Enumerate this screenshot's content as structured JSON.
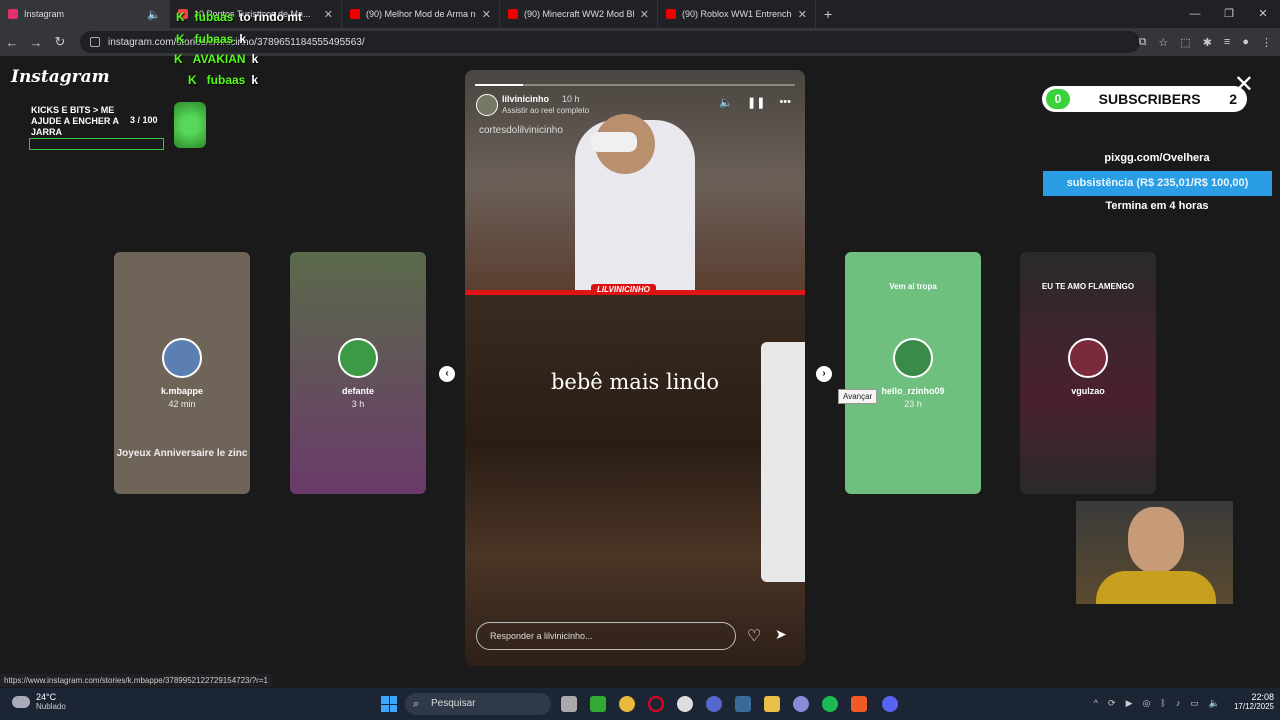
{
  "browser": {
    "tabs": [
      {
        "label": "Instagram",
        "fav_color": "#e1306c",
        "active": true
      },
      {
        "label": "10 Pontos Turísticos de Ma...",
        "fav_color": "#e44",
        "active": false
      },
      {
        "label": "(90) Melhor Mod de Arma no M",
        "fav_color": "#e00",
        "active": false
      },
      {
        "label": "(90) Minecraft WW2 Mod Block",
        "fav_color": "#e00",
        "active": false
      },
      {
        "label": "(90) Roblox WW1 Entrenched (l",
        "fav_color": "#e00",
        "active": false
      }
    ],
    "url": "instagram.com/stories/lilvinicinho/3789651184555495563/",
    "status_url": "https://www.instagram.com/stories/k.mbappe/3789952122729154723/?r=1"
  },
  "instagram": {
    "logo": "Instagram",
    "cards_left": [
      {
        "name": "k.mbappe",
        "time": "42 min",
        "bg": "#6e6558",
        "avatar": "#5a7fb0",
        "caption": "Joyeux Anniversaire le zinc"
      },
      {
        "name": "defante",
        "time": "3 h",
        "bg": "#4a5a3a",
        "avatar": "#3c9a46",
        "caption": ""
      }
    ],
    "cards_right": [
      {
        "name": "hello_rzinho09",
        "time": "23 h",
        "bg": "#6fbf7f",
        "avatar": "#3a8a4a",
        "caption": "Vem aí tropa"
      },
      {
        "name": "vgulzao",
        "time": "",
        "bg": "#3a2230",
        "avatar": "#7a2a3a",
        "caption": "EU TE AMO FLAMENGO"
      }
    ],
    "story": {
      "username": "lilvinicinho",
      "time": "10 h",
      "sub": "Assistir ao reel completo",
      "watermark": "cortesdolilvinicinho",
      "tag": "LILVINICINHO",
      "caption": "bebê mais lindo",
      "reply_placeholder": "Responder a lilvinicinho...",
      "progress": 0.15
    },
    "tooltip": "Avançar"
  },
  "overlay": {
    "jar_label": "KICKS E BITS > ME AJUDE A ENCHER A JARRA",
    "jar_count": "3  / 100",
    "chat": [
      {
        "user": "fubaas",
        "msg": "to rindo mt"
      },
      {
        "user": "fubaas",
        "msg": "k"
      },
      {
        "user": "AVAKIAN",
        "msg": "k"
      },
      {
        "user": "fubaas",
        "msg": "k"
      }
    ],
    "subs_left": "0",
    "subs_label": "SUBSCRIBERS",
    "subs_right": "2",
    "pix_url": "pixgg.com/Ovelhera",
    "pix_goal": "subsistência (R$ 235,01/R$ 100,00)",
    "pix_ends": "Termina em 4 horas"
  },
  "taskbar": {
    "temp": "24°C",
    "weather": "Nublado",
    "search": "Pesquisar",
    "time": "22:08",
    "date": "17/12/2025"
  }
}
